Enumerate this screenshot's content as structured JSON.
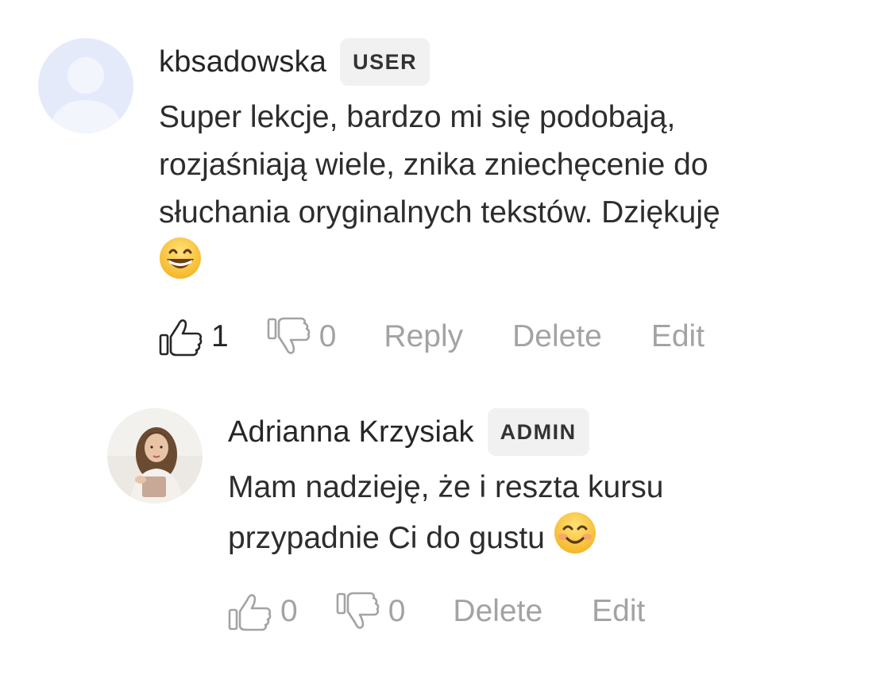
{
  "comments": [
    {
      "author": "kbsadowska",
      "role": "USER",
      "text_line1": "Super lekcje, bardzo mi się podobają,",
      "text_line2": "rozjaśniają wiele, znika zniechęcenie do",
      "text_line3": "słuchania oryginalnych tekstów. Dziękuję",
      "emoji": "grinning-face-with-smiling-eyes",
      "likes": "1",
      "dislikes": "0",
      "actions": {
        "reply": "Reply",
        "delete": "Delete",
        "edit": "Edit"
      }
    },
    {
      "author": "Adrianna Krzysiak",
      "role": "ADMIN",
      "text_line1": "Mam nadzieję, że i reszta kursu",
      "text_line2": "przypadnie Ci do gustu",
      "emoji": "smiling-face-with-smiling-eyes",
      "likes": "0",
      "dislikes": "0",
      "actions": {
        "delete": "Delete",
        "edit": "Edit"
      }
    }
  ],
  "colors": {
    "text": "#2b2b2b",
    "muted": "#a3a3a3",
    "badge_bg": "#f1f1f1",
    "default_avatar_bg": "#e4e9fb"
  }
}
